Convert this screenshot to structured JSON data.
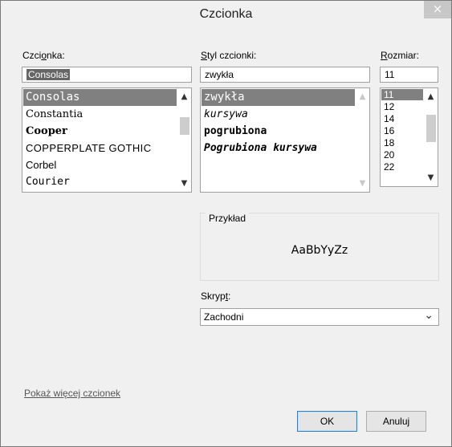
{
  "dialog": {
    "title": "Czcionka",
    "close_glyph": "×"
  },
  "font": {
    "label_pre": "Czci",
    "label_acc": "o",
    "label_post": "nka:",
    "value": "Consolas",
    "items": [
      "Consolas",
      "Constantia",
      "Cooper",
      "COPPERPLATE GOTHIC",
      "Corbel",
      "Courier"
    ]
  },
  "style": {
    "label_acc": "S",
    "label_post": "tyl czcionki:",
    "value": "zwykła",
    "items": [
      "zwykła",
      "kursywa",
      "pogrubiona",
      "Pogrubiona kursywa"
    ]
  },
  "size": {
    "label_acc": "R",
    "label_post": "ozmiar:",
    "value": "11",
    "items": [
      "11",
      "12",
      "14",
      "16",
      "18",
      "20",
      "22"
    ]
  },
  "sample": {
    "label": "Przykład",
    "text": "AaBbYyZz"
  },
  "script": {
    "label_pre": "Skryp",
    "label_acc": "t",
    "label_post": ":",
    "value": "Zachodni"
  },
  "more_fonts_link": "Pokaż więcej czcionek",
  "buttons": {
    "ok": "OK",
    "cancel": "Anuluj"
  },
  "glyphs": {
    "up": "▲",
    "down": "▼",
    "chevron": "⌄"
  }
}
